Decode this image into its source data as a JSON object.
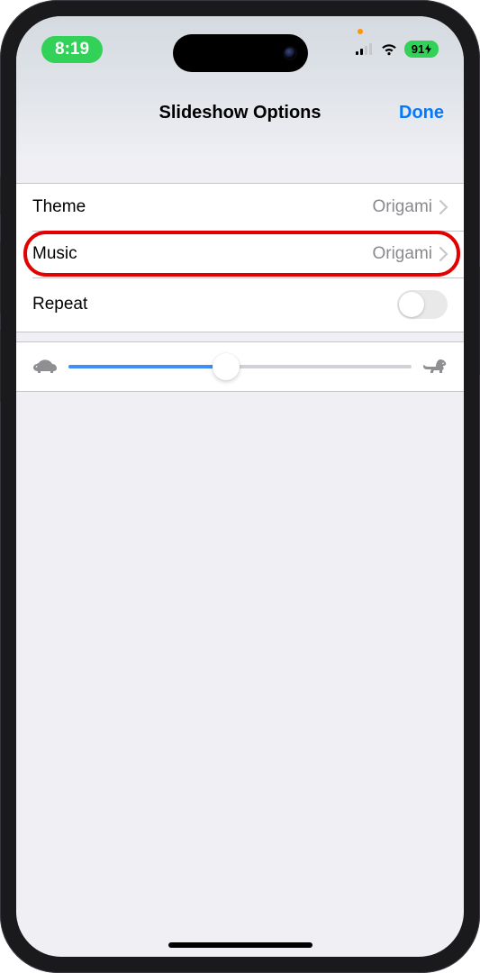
{
  "status_bar": {
    "time": "8:19",
    "battery_text": "91"
  },
  "header": {
    "title": "Slideshow Options",
    "done_label": "Done"
  },
  "rows": {
    "theme": {
      "label": "Theme",
      "value": "Origami"
    },
    "music": {
      "label": "Music",
      "value": "Origami"
    },
    "repeat": {
      "label": "Repeat",
      "toggle_on": false
    }
  },
  "speed_slider": {
    "value_percent": 46
  }
}
